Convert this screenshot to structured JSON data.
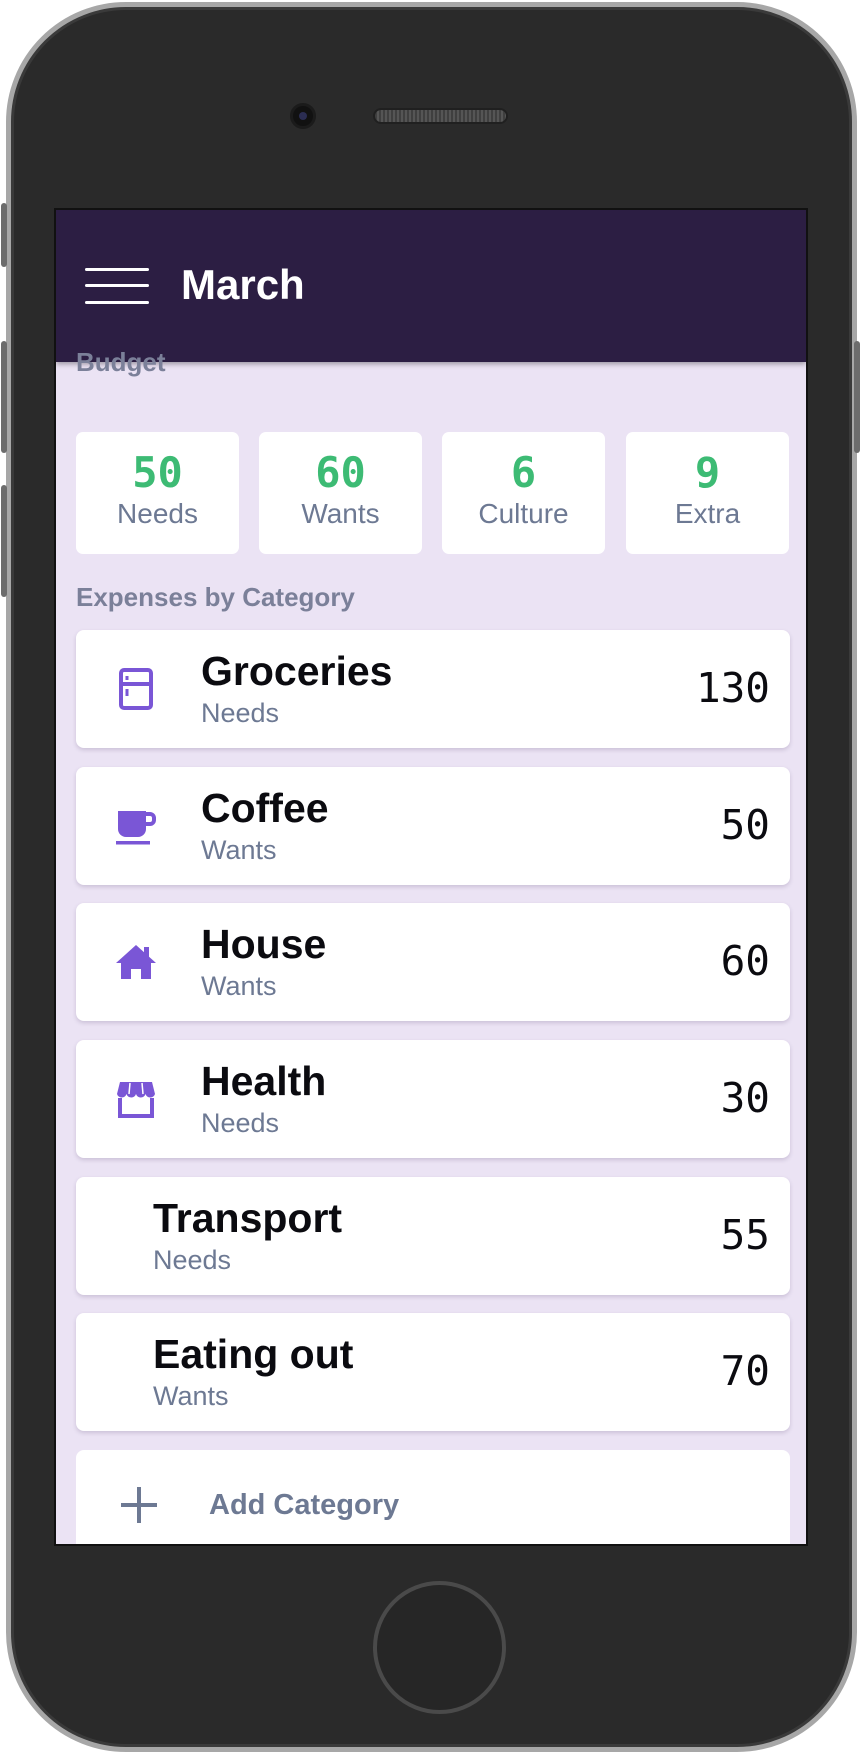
{
  "header": {
    "title": "March",
    "menu_icon": "hamburger-menu-icon"
  },
  "budget": {
    "label": "Budget",
    "items": [
      {
        "value": "50",
        "label": "Needs"
      },
      {
        "value": "60",
        "label": "Wants"
      },
      {
        "value": "6",
        "label": "Culture"
      },
      {
        "value": "9",
        "label": "Extra"
      }
    ]
  },
  "expenses": {
    "label": "Expenses by Category",
    "items": [
      {
        "name": "Groceries",
        "category": "Needs",
        "amount": "130",
        "icon": "fridge-icon"
      },
      {
        "name": "Coffee",
        "category": "Wants",
        "amount": "50",
        "icon": "coffee-cup-icon"
      },
      {
        "name": "House",
        "category": "Wants",
        "amount": "60",
        "icon": "house-icon"
      },
      {
        "name": "Health",
        "category": "Needs",
        "amount": "30",
        "icon": "store-icon"
      },
      {
        "name": "Transport",
        "category": "Needs",
        "amount": "55"
      },
      {
        "name": "Eating out",
        "category": "Wants",
        "amount": "70"
      }
    ]
  },
  "add_category": {
    "label": "Add Category",
    "icon": "plus-icon"
  },
  "colors": {
    "topbar": "#2c1e43",
    "background": "#ebe3f4",
    "budget_value": "#3dbb74",
    "icon_accent": "#7a56d6",
    "muted_text": "#6d7993"
  }
}
